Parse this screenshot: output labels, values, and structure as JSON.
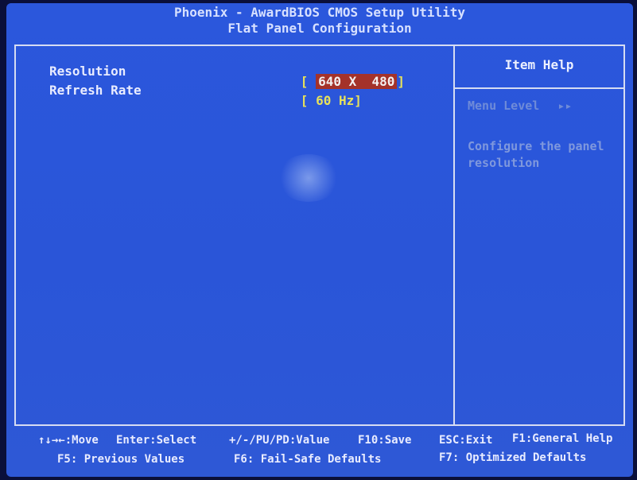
{
  "header": {
    "title": "Phoenix - AwardBIOS CMOS Setup Utility",
    "subtitle": "Flat Panel Configuration"
  },
  "settings": [
    {
      "label": "Resolution",
      "value": "640 X  480",
      "selected": true
    },
    {
      "label": "Refresh Rate",
      "value": "60 Hz",
      "selected": false
    }
  ],
  "help": {
    "title": "Item Help",
    "menu_level": "Menu Level",
    "menu_level_marker": "▸▸",
    "text": "Configure the panel resolution"
  },
  "footer": {
    "line1": {
      "move": "↑↓→←:Move",
      "select": "Enter:Select",
      "value": "+/-/PU/PD:Value",
      "save": "F10:Save",
      "exit": "ESC:Exit",
      "help": "F1:General Help"
    },
    "line2": {
      "previous": "F5: Previous Values",
      "failsafe": "F6: Fail-Safe Defaults",
      "optimized": "F7: Optimized Defaults"
    }
  },
  "colors": {
    "background": "#2b57dc",
    "selected_value_bg": "#a4322a",
    "value_text": "#e8e25a"
  }
}
